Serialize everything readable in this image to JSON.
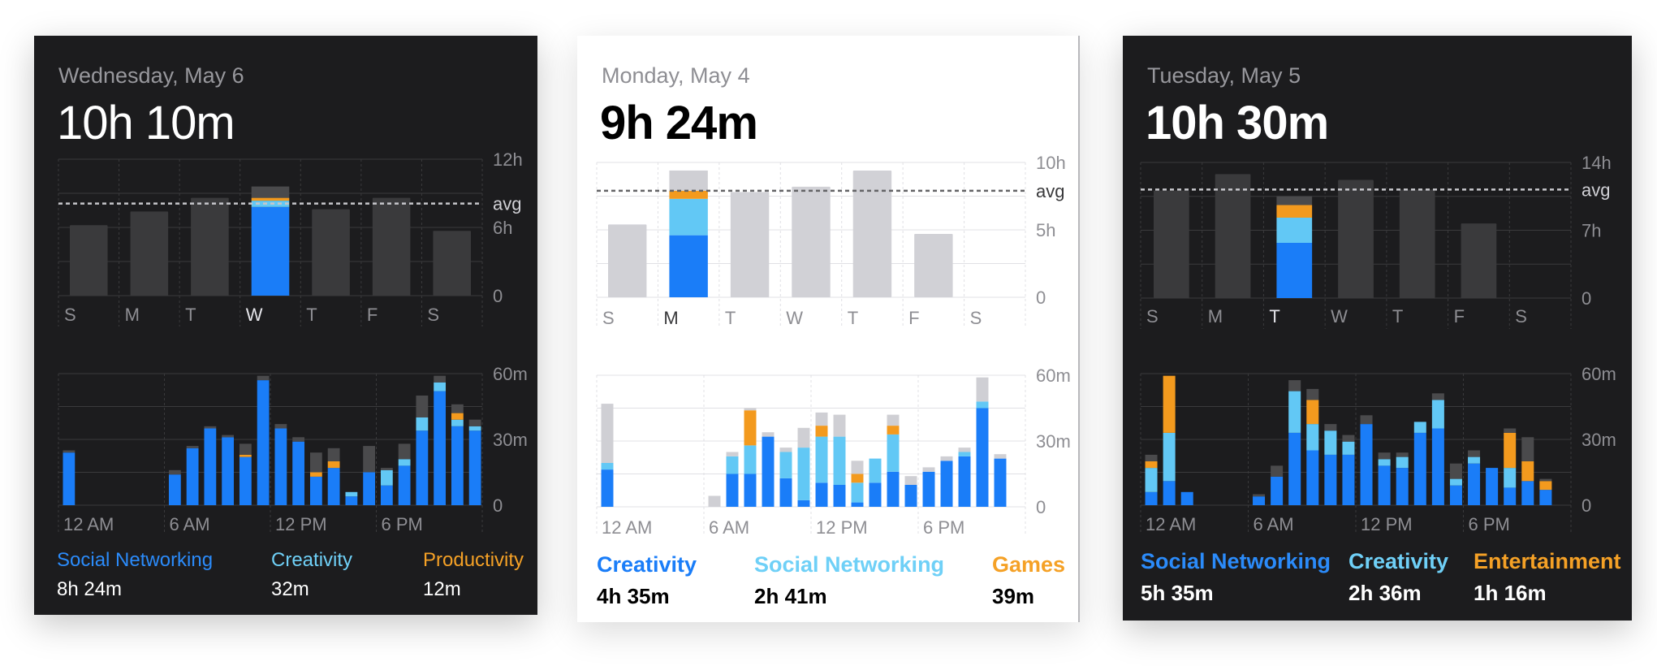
{
  "colors": {
    "social_networking": "#1a7df8",
    "creativity": "#62c8f5",
    "productivity": "#f39a1e",
    "games": "#f39a1e",
    "entertainment": "#f39a1e",
    "other_dark": "#4a4a4c",
    "other_light": "#cfcfd4",
    "bar_dark": "#3a3a3c",
    "bar_light": "#d1d1d6",
    "grid_dark": "#3a3a3c",
    "grid_light": "#e0e0e4",
    "legend_blue": "#2b8bfa",
    "legend_cyan": "#6fd0f7",
    "legend_orange": "#f5a126"
  },
  "cards": [
    {
      "id": "card-a",
      "theme": "dark",
      "date": "Wednesday, May 6",
      "total": "10h 10m",
      "legend": [
        {
          "name": "Social Networking",
          "time": "8h 24m",
          "color": "legend_blue"
        },
        {
          "name": "Creativity",
          "time": "32m",
          "color": "legend_cyan"
        },
        {
          "name": "Productivity",
          "time": "12m",
          "color": "legend_orange"
        }
      ]
    },
    {
      "id": "card-b",
      "theme": "light",
      "date": "Monday, May 4",
      "total": "9h 24m",
      "legend": [
        {
          "name": "Creativity",
          "time": "4h 35m",
          "color": "social_networking"
        },
        {
          "name": "Social Networking",
          "time": "2h 41m",
          "color": "legend_cyan"
        },
        {
          "name": "Games",
          "time": "39m",
          "color": "legend_orange"
        }
      ]
    },
    {
      "id": "card-c",
      "theme": "dark",
      "date": "Tuesday, May 5",
      "total": "10h 30m",
      "legend": [
        {
          "name": "Social Networking",
          "time": "5h 35m",
          "color": "legend_blue"
        },
        {
          "name": "Creativity",
          "time": "2h 36m",
          "color": "legend_cyan"
        },
        {
          "name": "Entertainment",
          "time": "1h 16m",
          "color": "legend_orange"
        }
      ]
    }
  ],
  "chart_data": [
    {
      "type": "bar",
      "card": "card-a",
      "chart": "weekly",
      "categories": [
        "S",
        "M",
        "T",
        "W",
        "T",
        "F",
        "S"
      ],
      "highlight_index": 3,
      "ylim": [
        0,
        12
      ],
      "unit": "hours",
      "y_ticks": [
        "12h",
        "6h",
        "0"
      ],
      "avg_label": "avg",
      "avg_value": 8.1,
      "values": [
        6.2,
        7.4,
        8.6,
        10.2,
        7.6,
        8.6,
        5.7
      ],
      "highlight_stack": [
        {
          "series": "social_networking",
          "value": 7.8
        },
        {
          "series": "creativity",
          "value": 0.55
        },
        {
          "series": "productivity",
          "value": 0.25
        },
        {
          "series": "other_dark",
          "value": 1.0
        }
      ]
    },
    {
      "type": "bar",
      "card": "card-a",
      "chart": "hourly",
      "ylim": [
        0,
        60
      ],
      "unit": "minutes",
      "y_ticks": [
        "60m",
        "30m",
        "0"
      ],
      "x_ticks": [
        "12 AM",
        "6 AM",
        "12 PM",
        "6 PM"
      ],
      "series_order": [
        "social_networking",
        "creativity",
        "productivity",
        "other"
      ],
      "hours": [
        [
          24,
          0,
          0,
          1
        ],
        [
          0,
          0,
          0,
          0
        ],
        [
          0,
          0,
          0,
          0
        ],
        [
          0,
          0,
          0,
          0
        ],
        [
          0,
          0,
          0,
          0
        ],
        [
          0,
          0,
          0,
          0
        ],
        [
          14,
          0,
          0,
          2
        ],
        [
          26,
          0,
          0,
          1
        ],
        [
          35,
          0,
          0,
          1
        ],
        [
          31,
          0,
          0,
          1
        ],
        [
          22,
          0,
          1,
          5
        ],
        [
          57,
          0,
          0,
          2
        ],
        [
          35,
          0,
          0,
          2
        ],
        [
          29,
          0,
          0,
          2
        ],
        [
          13,
          0,
          2,
          9
        ],
        [
          17,
          0,
          3,
          6
        ],
        [
          4,
          2,
          0,
          0
        ],
        [
          15,
          0,
          0,
          12
        ],
        [
          9,
          7,
          0,
          1
        ],
        [
          18,
          3,
          0,
          7
        ],
        [
          34,
          6,
          0,
          10
        ],
        [
          52,
          4,
          0,
          3
        ],
        [
          36,
          3,
          3,
          4
        ],
        [
          34,
          2,
          0,
          3
        ]
      ]
    },
    {
      "type": "bar",
      "card": "card-b",
      "chart": "weekly",
      "categories": [
        "S",
        "M",
        "T",
        "W",
        "T",
        "F",
        "S"
      ],
      "highlight_index": 1,
      "ylim": [
        0,
        10
      ],
      "unit": "hours",
      "y_ticks": [
        "10h",
        "5h",
        "0"
      ],
      "avg_label": "avg",
      "avg_value": 7.9,
      "values": [
        5.4,
        9.4,
        7.8,
        8.2,
        9.4,
        4.7,
        0
      ],
      "highlight_stack": [
        {
          "series": "social_networking",
          "value": 4.6
        },
        {
          "series": "creativity",
          "value": 2.7
        },
        {
          "series": "games",
          "value": 0.6
        },
        {
          "series": "other_light",
          "value": 1.5
        }
      ]
    },
    {
      "type": "bar",
      "card": "card-b",
      "chart": "hourly",
      "ylim": [
        0,
        60
      ],
      "unit": "minutes",
      "y_ticks": [
        "60m",
        "30m",
        "0"
      ],
      "x_ticks": [
        "12 AM",
        "6 AM",
        "12 PM",
        "6 PM"
      ],
      "series_order": [
        "social_networking",
        "creativity",
        "games",
        "other"
      ],
      "hours": [
        [
          17,
          3,
          0,
          27
        ],
        [
          0,
          0,
          0,
          0
        ],
        [
          0,
          0,
          0,
          0
        ],
        [
          0,
          0,
          0,
          0
        ],
        [
          0,
          0,
          0,
          0
        ],
        [
          0,
          0,
          0,
          0
        ],
        [
          0,
          0,
          0,
          5
        ],
        [
          15,
          8,
          0,
          2
        ],
        [
          15,
          13,
          16,
          1
        ],
        [
          32,
          0,
          0,
          2
        ],
        [
          13,
          12,
          0,
          2
        ],
        [
          3,
          24,
          0,
          9
        ],
        [
          11,
          21,
          5,
          6
        ],
        [
          10,
          22,
          0,
          10
        ],
        [
          2,
          9,
          4,
          6
        ],
        [
          11,
          11,
          0,
          0
        ],
        [
          16,
          17,
          4,
          5
        ],
        [
          10,
          0,
          0,
          4
        ],
        [
          16,
          0,
          0,
          2
        ],
        [
          21,
          0,
          0,
          2
        ],
        [
          23,
          2,
          0,
          2
        ],
        [
          45,
          3,
          0,
          11
        ],
        [
          22,
          0,
          0,
          2
        ],
        [
          0,
          0,
          0,
          0
        ]
      ]
    },
    {
      "type": "bar",
      "card": "card-c",
      "chart": "weekly",
      "categories": [
        "S",
        "M",
        "T",
        "W",
        "T",
        "F",
        "S"
      ],
      "highlight_index": 2,
      "ylim": [
        0,
        14
      ],
      "unit": "hours",
      "y_ticks": [
        "14h",
        "7h",
        "0"
      ],
      "avg_label": "avg",
      "avg_value": 11.2,
      "values": [
        11.1,
        12.8,
        10.5,
        12.2,
        11.2,
        7.7,
        0
      ],
      "highlight_stack": [
        {
          "series": "social_networking",
          "value": 5.7
        },
        {
          "series": "creativity",
          "value": 2.6
        },
        {
          "series": "entertainment",
          "value": 1.3
        },
        {
          "series": "other_dark",
          "value": 0.9
        }
      ]
    },
    {
      "type": "bar",
      "card": "card-c",
      "chart": "hourly",
      "ylim": [
        0,
        60
      ],
      "unit": "minutes",
      "y_ticks": [
        "60m",
        "30m",
        "0"
      ],
      "x_ticks": [
        "12 AM",
        "6 AM",
        "12 PM",
        "6 PM"
      ],
      "series_order": [
        "social_networking",
        "creativity",
        "entertainment",
        "other"
      ],
      "hours": [
        [
          6,
          11,
          3,
          3
        ],
        [
          11,
          22,
          26,
          0
        ],
        [
          6,
          0,
          0,
          0
        ],
        [
          0,
          0,
          0,
          0
        ],
        [
          0,
          0,
          0,
          0
        ],
        [
          0,
          0,
          0,
          0
        ],
        [
          4,
          0,
          0,
          1
        ],
        [
          13,
          0,
          0,
          5
        ],
        [
          33,
          19,
          0,
          5
        ],
        [
          25,
          12,
          11,
          5
        ],
        [
          23,
          11,
          0,
          3
        ],
        [
          23,
          6,
          0,
          3
        ],
        [
          37,
          0,
          0,
          4
        ],
        [
          18,
          3,
          0,
          3
        ],
        [
          17,
          5,
          0,
          2
        ],
        [
          33,
          5,
          0,
          0
        ],
        [
          35,
          13,
          0,
          3
        ],
        [
          9,
          3,
          0,
          7
        ],
        [
          19,
          3,
          0,
          3
        ],
        [
          17,
          0,
          0,
          0
        ],
        [
          8,
          9,
          16,
          2
        ],
        [
          11,
          0,
          9,
          11
        ],
        [
          7,
          0,
          4,
          1
        ],
        [
          0,
          0,
          0,
          0
        ]
      ]
    }
  ]
}
